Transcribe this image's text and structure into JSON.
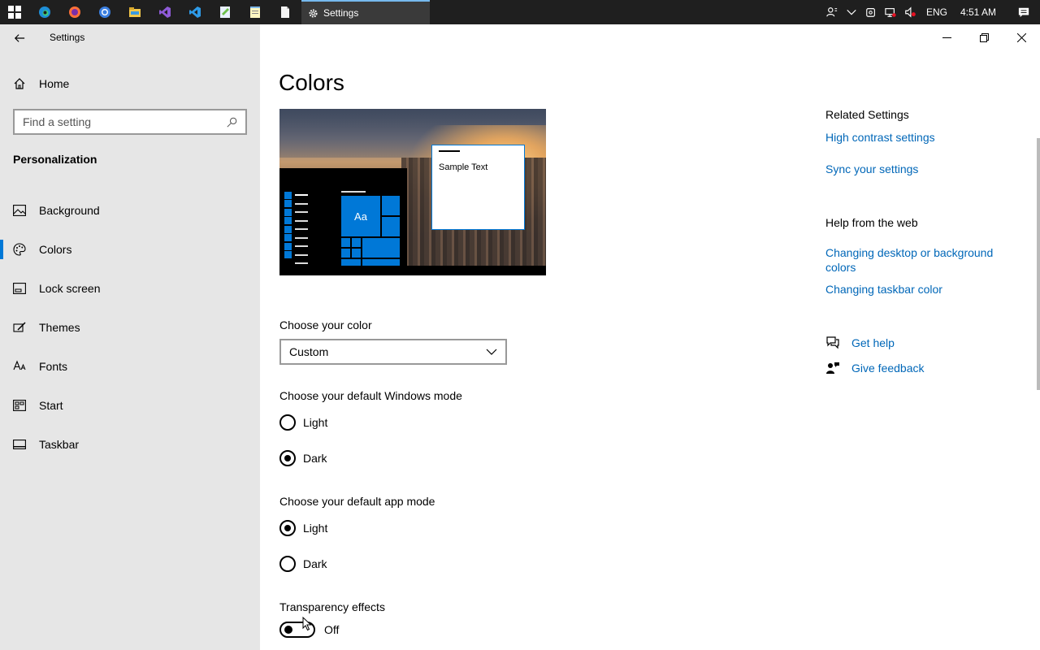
{
  "taskbar": {
    "active_app_label": "Settings",
    "apps": [
      "windows-start-icon",
      "edge-icon",
      "firefox-icon",
      "chrome-icon",
      "file-explorer-icon",
      "visual-studio-icon",
      "vscode-icon",
      "notepad-plus-icon",
      "notepad-icon",
      "document-icon"
    ],
    "tray": {
      "language": "ENG",
      "time": "4:51 AM"
    }
  },
  "sidebar": {
    "app_title": "Settings",
    "home_label": "Home",
    "search_placeholder": "Find a setting",
    "section_title": "Personalization",
    "items": [
      {
        "label": "Background",
        "icon": "image-icon"
      },
      {
        "label": "Colors",
        "icon": "palette-icon",
        "active": true
      },
      {
        "label": "Lock screen",
        "icon": "lock-screen-icon"
      },
      {
        "label": "Themes",
        "icon": "brush-icon"
      },
      {
        "label": "Fonts",
        "icon": "font-icon"
      },
      {
        "label": "Start",
        "icon": "start-icon"
      },
      {
        "label": "Taskbar",
        "icon": "taskbar-icon"
      }
    ]
  },
  "main": {
    "title": "Colors",
    "preview": {
      "tile_text": "Aa",
      "sample_text": "Sample Text"
    },
    "choose_color": {
      "label": "Choose your color",
      "selected": "Custom"
    },
    "windows_mode": {
      "label": "Choose your default Windows mode",
      "options": [
        "Light",
        "Dark"
      ],
      "selected": "Dark"
    },
    "app_mode": {
      "label": "Choose your default app mode",
      "options": [
        "Light",
        "Dark"
      ],
      "selected": "Light"
    },
    "transparency": {
      "label": "Transparency effects",
      "state": "Off"
    }
  },
  "right": {
    "related_title": "Related Settings",
    "related_links": [
      "High contrast settings",
      "Sync your settings"
    ],
    "help_title": "Help from the web",
    "help_links": [
      "Changing desktop or background colors",
      "Changing taskbar color"
    ],
    "get_help": "Get help",
    "give_feedback": "Give feedback"
  },
  "colors": {
    "accent": "#0078d7",
    "link": "#0067b8",
    "sidebar_bg": "#e6e6e6",
    "taskbar_bg": "#1f1f1f"
  }
}
